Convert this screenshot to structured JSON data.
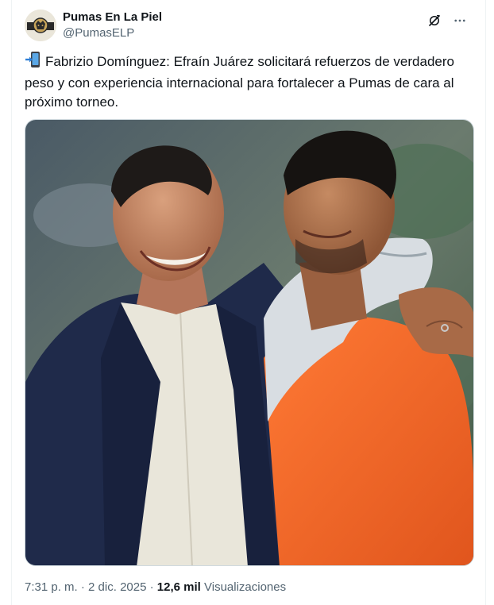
{
  "author": {
    "display_name": "Pumas En La Piel",
    "handle": "@PumasELP"
  },
  "icons": {
    "grok": "grok-icon",
    "more": "more-icon",
    "emoji": "mobile-arrow-icon"
  },
  "tweet": {
    "text": "Fabrizio Domínguez: Efraín Juárez solicitará refuerzos de verdadero peso y con experiencia internacional para fortalecer a Pumas de cara al próximo torneo."
  },
  "meta": {
    "time": "7:31 p. m.",
    "separator": "·",
    "date": "2 dic. 2025",
    "views_count": "12,6 mil",
    "views_label": "Visualizaciones"
  },
  "colors": {
    "text": "#0f1419",
    "secondary": "#536471",
    "shirt_orange": "#f26a2a",
    "jacket_navy": "#1f2a4a"
  }
}
